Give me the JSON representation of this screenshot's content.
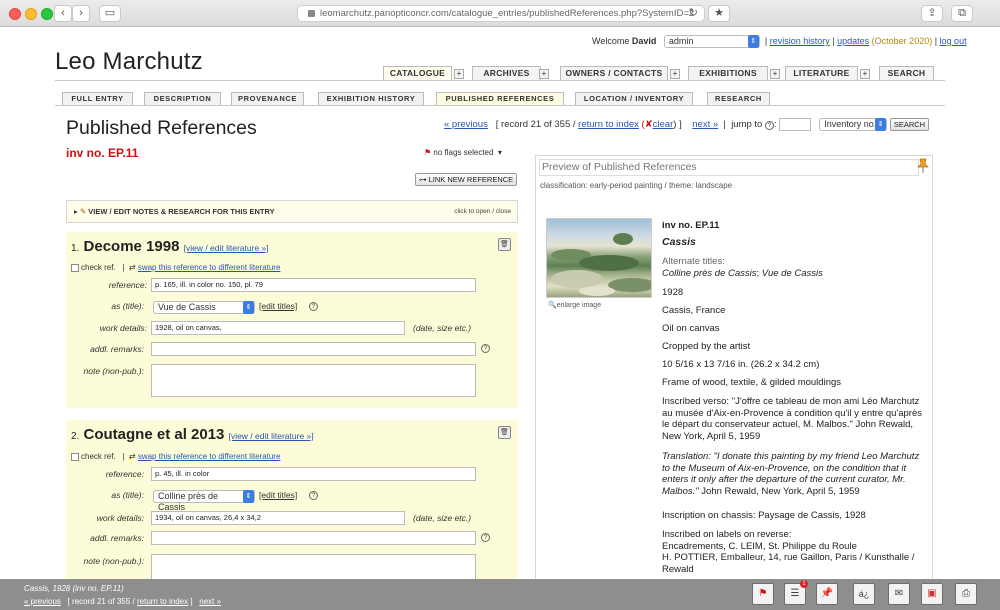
{
  "browser": {
    "url": "leomarchutz.panopticoncr.com/catalogue_entries/publishedReferences.php?SystemID=2",
    "back_icon": "chevron-left-icon",
    "forward_icon": "chevron-right-icon"
  },
  "header": {
    "welcome_prefix": "Welcome",
    "user": "David",
    "role_select": "admin",
    "revision_history": "revision history",
    "updates": "updates",
    "updates_date": "(October 2020)",
    "logout": "log out",
    "site_title": "Leo Marchutz"
  },
  "main_tabs": [
    {
      "label": "CATALOGUE"
    },
    {
      "label": "ARCHIVES"
    },
    {
      "label": "OWNERS / CONTACTS"
    },
    {
      "label": "EXHIBITIONS"
    },
    {
      "label": "LITERATURE"
    },
    {
      "label": "SEARCH"
    }
  ],
  "sub_tabs": [
    {
      "label": "FULL ENTRY"
    },
    {
      "label": "DESCRIPTION"
    },
    {
      "label": "PROVENANCE"
    },
    {
      "label": "EXHIBITION HISTORY"
    },
    {
      "label": "PUBLISHED REFERENCES"
    },
    {
      "label": "LOCATION / INVENTORY"
    },
    {
      "label": "RESEARCH"
    }
  ],
  "page": {
    "heading": "Published References",
    "previous": "« previous",
    "record_text": "[ record 21 of 355 /",
    "return_to_index": "return to index",
    "clear_prefix": "(✘",
    "clear": "clear",
    "clear_suffix": ")",
    "bracket_close": "]",
    "next": "next »",
    "jump_to": "jump to",
    "jump_select": "Inventory no.",
    "search_button": "SEARCH",
    "inv_no": "inv no. EP.11",
    "flags": "no flags selected",
    "link_new_reference": "LINK NEW REFERENCE",
    "notes_bar": "VIEW / EDIT NOTES & RESEARCH FOR THIS ENTRY",
    "notes_bar_hint": "click to open / close"
  },
  "references": [
    {
      "num": "1.",
      "title": "Decome 1998",
      "view_edit": "[view / edit literature »]",
      "check_ref": "check ref.",
      "swap": "swap this reference to different literature",
      "reference_label": "reference:",
      "reference": "p. 165, ill. in color no. 150,  pl. 79",
      "as_title_label": "as (title):",
      "as_title": "Vue de Cassis",
      "edit_titles": "[edit titles]",
      "work_details_label": "work details:",
      "work_details": "1928, oil on canvas,",
      "work_details_hint": "(date, size etc.)",
      "addl_remarks_label": "addl. remarks:",
      "addl_remarks": "",
      "note_label": "note (non-pub.):",
      "note": ""
    },
    {
      "num": "2.",
      "title": "Coutagne et al 2013",
      "view_edit": "[view / edit literature »]",
      "check_ref": "check ref.",
      "swap": "swap this reference to different literature",
      "reference_label": "reference:",
      "reference": "p. 45, ill. in color",
      "as_title_label": "as (title):",
      "as_title": "Colline près de Cassis",
      "edit_titles": "[edit titles]",
      "work_details_label": "work details:",
      "work_details": "1934, oil on canvas, 26,4 x 34,2",
      "work_details_hint": "(date, size etc.)",
      "addl_remarks_label": "addl. remarks:",
      "addl_remarks": "",
      "note_label": "note (non-pub.):",
      "note": ""
    }
  ],
  "preview": {
    "heading": "Preview of Published References",
    "classification": "classification: early-period painting  /  theme: landscape",
    "enlarge": "enlarge image",
    "inv_no": "inv no. EP.11",
    "title": "Cassis",
    "alt_titles_label": "Alternate titles:",
    "alt_title_1": "Colline près de Cassis",
    "alt_sep": "; ",
    "alt_title_2": "Vue de Cassis",
    "date": "1928",
    "place": "Cassis, France",
    "medium": "Oil on canvas",
    "cropped": "Cropped by the artist",
    "dimensions": "10 5/16 x 13 7/16 in. (26.2 x 34.2 cm)",
    "frame": "Frame of wood, textile, & gilded mouldings",
    "inscribed_verso": "Inscribed verso: \"J'offre ce tableau de mon ami Léo Marchutz au musée d'Aix-en-Provence à condition qu'il y entre qu'après le départ du conservateur actuel, M. Malbos.\" John Rewald, New York, April 5, 1959",
    "translation_italic": "Translation: \"I donate this painting by my friend Leo Marchutz to the Museum of Aix-en-Provence, on the condition that it enters it only after the departure of the current curator, Mr. Malbos.\"",
    "translation_rest": " John Rewald, New York, April 5, 1959",
    "chassis": "Inscription on chassis: Paysage de Cassis, 1928",
    "labels_1": "Inscribed on labels on reverse:",
    "labels_2": "Encadrements, C. LEIM, St. Philippe du Roule",
    "labels_3": "H. POTTIER, Emballeur, 14, rue Gaillon, Paris / Kunsthalle / Rewald"
  },
  "bottom": {
    "line1": "Cassis, 1928 (inv no. EP.11)",
    "previous": "« previous",
    "record": "[ record 21 of 355 /",
    "return_to_index": "return to index",
    "bracket_close": "]",
    "next": "next »",
    "badge_count": "1",
    "lang_icon_text": "á¿"
  },
  "colors": {
    "inv_red": "#cc1111",
    "link_blue": "#2a55b5",
    "ref_bg": "#fdfcd8",
    "bottom_bar": "#8e8e8e"
  }
}
